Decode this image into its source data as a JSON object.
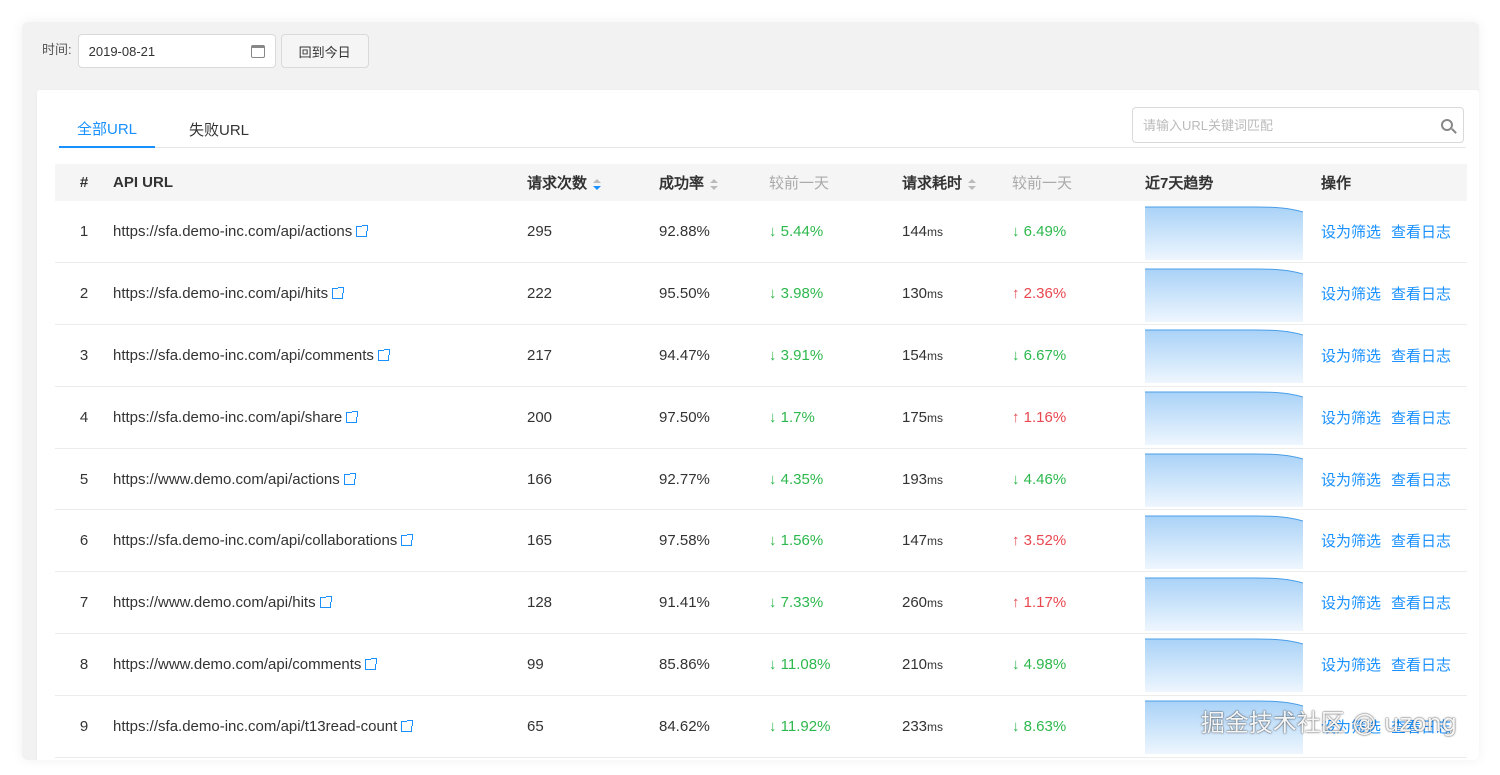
{
  "filter": {
    "label": "时间:",
    "date": "2019-08-21",
    "today_button": "回到今日"
  },
  "tabs": [
    {
      "label": "全部URL"
    },
    {
      "label": "失败URL"
    }
  ],
  "search": {
    "placeholder": "请输入URL关键词匹配"
  },
  "columns": [
    "#",
    "API URL",
    "请求次数",
    "成功率",
    "较前一天",
    "请求耗时",
    "较前一天",
    "近7天趋势",
    "操作"
  ],
  "time_unit": "ms",
  "actions": {
    "filter": "设为筛选",
    "log": "查看日志"
  },
  "colors": {
    "accent": "#1890ff",
    "down": "#2db84d",
    "up": "#e8474f"
  },
  "rows": [
    {
      "idx": "1",
      "url": "https://sfa.demo-inc.com/api/actions",
      "count": "295",
      "rate": "92.88%",
      "rate_dir": "down",
      "rate_delta": "5.44%",
      "time": "144",
      "time_dir": "down",
      "time_delta": "6.49%"
    },
    {
      "idx": "2",
      "url": "https://sfa.demo-inc.com/api/hits",
      "count": "222",
      "rate": "95.50%",
      "rate_dir": "down",
      "rate_delta": "3.98%",
      "time": "130",
      "time_dir": "up",
      "time_delta": "2.36%"
    },
    {
      "idx": "3",
      "url": "https://sfa.demo-inc.com/api/comments",
      "count": "217",
      "rate": "94.47%",
      "rate_dir": "down",
      "rate_delta": "3.91%",
      "time": "154",
      "time_dir": "down",
      "time_delta": "6.67%"
    },
    {
      "idx": "4",
      "url": "https://sfa.demo-inc.com/api/share",
      "count": "200",
      "rate": "97.50%",
      "rate_dir": "down",
      "rate_delta": "1.7%",
      "time": "175",
      "time_dir": "up",
      "time_delta": "1.16%"
    },
    {
      "idx": "5",
      "url": "https://www.demo.com/api/actions",
      "count": "166",
      "rate": "92.77%",
      "rate_dir": "down",
      "rate_delta": "4.35%",
      "time": "193",
      "time_dir": "down",
      "time_delta": "4.46%"
    },
    {
      "idx": "6",
      "url": "https://sfa.demo-inc.com/api/collaborations",
      "count": "165",
      "rate": "97.58%",
      "rate_dir": "down",
      "rate_delta": "1.56%",
      "time": "147",
      "time_dir": "up",
      "time_delta": "3.52%"
    },
    {
      "idx": "7",
      "url": "https://www.demo.com/api/hits",
      "count": "128",
      "rate": "91.41%",
      "rate_dir": "down",
      "rate_delta": "7.33%",
      "time": "260",
      "time_dir": "up",
      "time_delta": "1.17%"
    },
    {
      "idx": "8",
      "url": "https://www.demo.com/api/comments",
      "count": "99",
      "rate": "85.86%",
      "rate_dir": "down",
      "rate_delta": "11.08%",
      "time": "210",
      "time_dir": "down",
      "time_delta": "4.98%"
    },
    {
      "idx": "9",
      "url": "https://sfa.demo-inc.com/api/t13read-count",
      "count": "65",
      "rate": "84.62%",
      "rate_dir": "down",
      "rate_delta": "11.92%",
      "time": "233",
      "time_dir": "down",
      "time_delta": "8.63%"
    }
  ],
  "watermark": "掘金技术社区 @ uzong"
}
